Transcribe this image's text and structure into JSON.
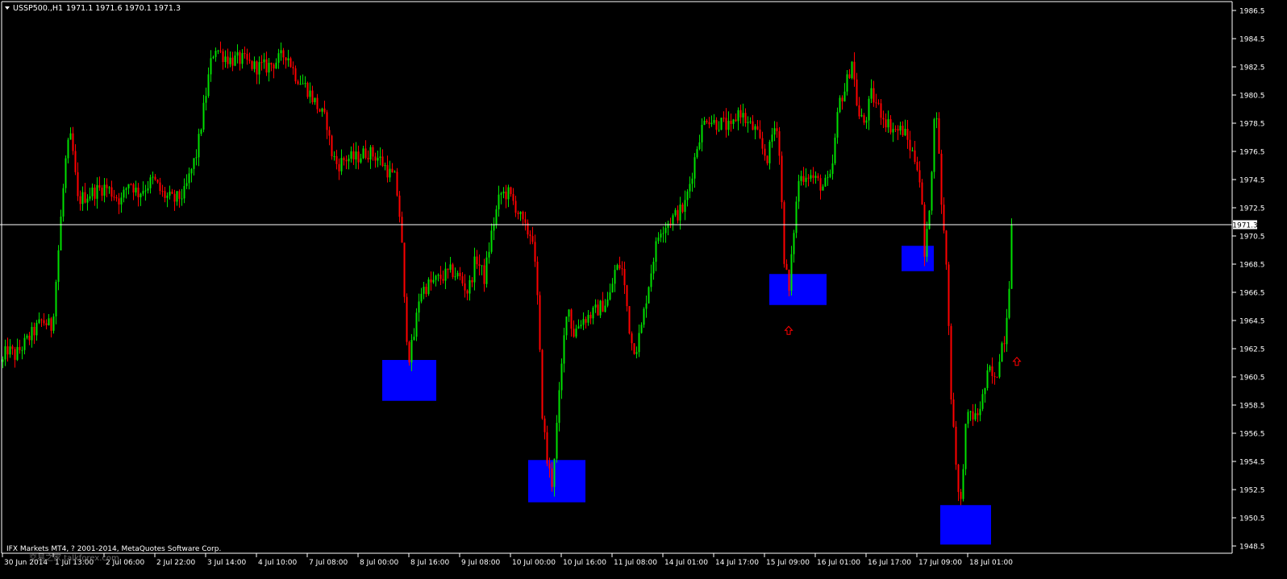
{
  "header": {
    "symbol": "USSP500.,H1",
    "ohlc": "1971.1 1971.6 1970.1 1971.3"
  },
  "copyright": "IFX Markets MT4, ? 2001-2014, MetaQuotes Software Corp.",
  "watermark": "交易之家 talkforex.com",
  "colors": {
    "background": "#000000",
    "bull": "#00e000",
    "bear": "#ff0000",
    "zone": "#0000ff",
    "axis": "#ffffff",
    "price_line": "#ffffff",
    "arrow": "#ff0000"
  },
  "chart_data": {
    "type": "candlestick",
    "ylim": [
      1947.5,
      1987.3
    ],
    "y_ticks": [
      "1986.5",
      "1984.5",
      "1982.5",
      "1980.5",
      "1978.5",
      "1976.5",
      "1974.5",
      "1972.5",
      "1970.5",
      "1968.5",
      "1966.5",
      "1964.5",
      "1962.5",
      "1960.5",
      "1958.5",
      "1956.5",
      "1954.5",
      "1952.5",
      "1950.5",
      "1948.5"
    ],
    "x_ticks": [
      "30 Jun 2014",
      "1 Jul 13:00",
      "2 Jul 06:00",
      "2 Jul 22:00",
      "3 Jul 14:00",
      "4 Jul 10:00",
      "7 Jul 08:00",
      "8 Jul 00:00",
      "8 Jul 16:00",
      "9 Jul 08:00",
      "10 Jul 00:00",
      "10 Jul 16:00",
      "11 Jul 08:00",
      "14 Jul 01:00",
      "14 Jul 17:00",
      "15 Jul 09:00",
      "16 Jul 01:00",
      "16 Jul 17:00",
      "17 Jul 09:00",
      "18 Jul 01:00"
    ],
    "current_price": "1971.3",
    "path": [
      [
        0,
        1961.0
      ],
      [
        8,
        1962.5
      ],
      [
        18,
        1962.0
      ],
      [
        32,
        1963.0
      ],
      [
        52,
        1964.5
      ],
      [
        64,
        1964.0
      ],
      [
        70,
        1968.0
      ],
      [
        76,
        1972.5
      ],
      [
        82,
        1976.5
      ],
      [
        88,
        1977.5
      ],
      [
        96,
        1973.0
      ],
      [
        110,
        1973.5
      ],
      [
        130,
        1974.0
      ],
      [
        150,
        1973.0
      ],
      [
        160,
        1974.5
      ],
      [
        170,
        1973.5
      ],
      [
        190,
        1974.5
      ],
      [
        200,
        1973.5
      ],
      [
        215,
        1973.0
      ],
      [
        228,
        1973.5
      ],
      [
        236,
        1975.0
      ],
      [
        244,
        1976.5
      ],
      [
        252,
        1979.5
      ],
      [
        260,
        1982.5
      ],
      [
        266,
        1984.0
      ],
      [
        272,
        1983.5
      ],
      [
        285,
        1983.0
      ],
      [
        300,
        1983.0
      ],
      [
        315,
        1982.5
      ],
      [
        330,
        1982.5
      ],
      [
        345,
        1983.0
      ],
      [
        355,
        1983.5
      ],
      [
        365,
        1982.0
      ],
      [
        380,
        1981.0
      ],
      [
        395,
        1979.5
      ],
      [
        405,
        1978.5
      ],
      [
        410,
        1976.5
      ],
      [
        418,
        1975.5
      ],
      [
        428,
        1976.0
      ],
      [
        440,
        1976.0
      ],
      [
        455,
        1976.5
      ],
      [
        470,
        1976.0
      ],
      [
        482,
        1975.0
      ],
      [
        490,
        1974.5
      ],
      [
        497,
        1971.0
      ],
      [
        502,
        1964.5
      ],
      [
        507,
        1962.0
      ],
      [
        512,
        1963.0
      ],
      [
        520,
        1966.5
      ],
      [
        530,
        1967.0
      ],
      [
        545,
        1967.5
      ],
      [
        560,
        1968.0
      ],
      [
        570,
        1967.5
      ],
      [
        580,
        1966.5
      ],
      [
        590,
        1969.0
      ],
      [
        600,
        1967.5
      ],
      [
        610,
        1971.0
      ],
      [
        620,
        1973.5
      ],
      [
        630,
        1973.5
      ],
      [
        640,
        1972.5
      ],
      [
        650,
        1971.0
      ],
      [
        660,
        1970.5
      ],
      [
        666,
        1966.0
      ],
      [
        672,
        1958.0
      ],
      [
        678,
        1954.5
      ],
      [
        684,
        1953.0
      ],
      [
        690,
        1957.0
      ],
      [
        695,
        1960.5
      ],
      [
        703,
        1966.0
      ],
      [
        710,
        1963.5
      ],
      [
        720,
        1964.5
      ],
      [
        735,
        1965.0
      ],
      [
        745,
        1965.5
      ],
      [
        755,
        1966.0
      ],
      [
        762,
        1968.0
      ],
      [
        770,
        1968.5
      ],
      [
        776,
        1966.0
      ],
      [
        782,
        1963.0
      ],
      [
        788,
        1962.5
      ],
      [
        795,
        1964.0
      ],
      [
        802,
        1966.5
      ],
      [
        810,
        1969.0
      ],
      [
        818,
        1971.0
      ],
      [
        828,
        1971.5
      ],
      [
        838,
        1972.0
      ],
      [
        848,
        1972.5
      ],
      [
        856,
        1974.5
      ],
      [
        866,
        1977.5
      ],
      [
        876,
        1979.0
      ],
      [
        886,
        1978.5
      ],
      [
        896,
        1978.5
      ],
      [
        906,
        1978.0
      ],
      [
        916,
        1979.5
      ],
      [
        926,
        1978.5
      ],
      [
        936,
        1978.0
      ],
      [
        946,
        1976.5
      ],
      [
        952,
        1976.0
      ],
      [
        958,
        1978.0
      ],
      [
        964,
        1978.5
      ],
      [
        968,
        1974.0
      ],
      [
        972,
        1969.0
      ],
      [
        978,
        1966.5
      ],
      [
        984,
        1971.0
      ],
      [
        990,
        1974.5
      ],
      [
        1000,
        1975.0
      ],
      [
        1010,
        1974.5
      ],
      [
        1020,
        1974.0
      ],
      [
        1030,
        1974.5
      ],
      [
        1040,
        1980.0
      ],
      [
        1048,
        1981.0
      ],
      [
        1056,
        1983.0
      ],
      [
        1064,
        1979.0
      ],
      [
        1072,
        1978.5
      ],
      [
        1080,
        1980.5
      ],
      [
        1090,
        1979.5
      ],
      [
        1100,
        1978.5
      ],
      [
        1110,
        1978.0
      ],
      [
        1120,
        1978.0
      ],
      [
        1130,
        1976.5
      ],
      [
        1138,
        1975.5
      ],
      [
        1142,
        1973.5
      ],
      [
        1146,
        1969.0
      ],
      [
        1150,
        1971.0
      ],
      [
        1154,
        1974.5
      ],
      [
        1160,
        1980.5
      ],
      [
        1164,
        1976.0
      ],
      [
        1168,
        1972.0
      ],
      [
        1174,
        1968.0
      ],
      [
        1178,
        1960.0
      ],
      [
        1184,
        1955.5
      ],
      [
        1190,
        1950.5
      ],
      [
        1196,
        1956.5
      ],
      [
        1202,
        1958.0
      ],
      [
        1210,
        1957.5
      ],
      [
        1218,
        1959.0
      ],
      [
        1226,
        1961.0
      ],
      [
        1234,
        1960.0
      ],
      [
        1240,
        1962.5
      ],
      [
        1246,
        1963.5
      ],
      [
        1252,
        1968.0
      ],
      [
        1256,
        1971.3
      ]
    ],
    "zones": [
      {
        "t0": 474,
        "t1": 541,
        "p_top": 1961.7,
        "p_bottom": 1958.8
      },
      {
        "t0": 655,
        "t1": 726,
        "p_top": 1954.6,
        "p_bottom": 1951.6
      },
      {
        "t0": 954,
        "t1": 1025,
        "p_top": 1967.8,
        "p_bottom": 1965.6
      },
      {
        "t0": 1118,
        "t1": 1158,
        "p_top": 1969.8,
        "p_bottom": 1968.0
      },
      {
        "t0": 1166,
        "t1": 1229,
        "p_top": 1951.4,
        "p_bottom": 1948.6
      }
    ],
    "arrows": [
      {
        "t": 978,
        "price": 1963.8
      },
      {
        "t": 1261,
        "price": 1961.6
      }
    ]
  }
}
